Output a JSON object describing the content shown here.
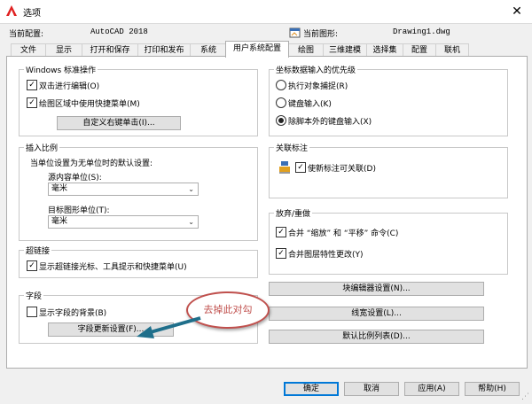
{
  "window": {
    "title": "选项",
    "close_label": "✕"
  },
  "profile": {
    "current_profile_label": "当前配置:",
    "current_profile_value": "AutoCAD 2018",
    "current_drawing_label": "当前图形:",
    "current_drawing_value": "Drawing1.dwg"
  },
  "tabs": [
    {
      "label": "文件"
    },
    {
      "label": "显示"
    },
    {
      "label": "打开和保存"
    },
    {
      "label": "打印和发布"
    },
    {
      "label": "系统"
    },
    {
      "label": "用户系统配置",
      "active": true
    },
    {
      "label": "绘图"
    },
    {
      "label": "三维建模"
    },
    {
      "label": "选择集"
    },
    {
      "label": "配置"
    },
    {
      "label": "联机"
    }
  ],
  "windows_std": {
    "title": "Windows 标准操作",
    "double_click_edit": {
      "label": "双击进行编辑(O)",
      "checked": true
    },
    "shortcut_menus": {
      "label": "绘图区域中使用快捷菜单(M)",
      "checked": true
    },
    "custom_right_click_button": "自定义右键单击(I)..."
  },
  "insertion_scale": {
    "title": "插入比例",
    "description": "当单位设置为无单位时的默认设置:",
    "source_label": "源内容单位(S):",
    "source_value": "毫米",
    "target_label": "目标图形单位(T):",
    "target_value": "毫米"
  },
  "hyperlink": {
    "title": "超链接",
    "show_cursor": {
      "label": "显示超链接光标、工具提示和快捷菜单(U)",
      "checked": true
    }
  },
  "fields": {
    "title": "字段",
    "show_background": {
      "label": "显示字段的背景(B)",
      "checked": false
    },
    "update_settings_button": "字段更新设置(F)..."
  },
  "coord_priority": {
    "title": "坐标数据输入的优先级",
    "options": [
      {
        "label": "执行对象捕捉(R)",
        "selected": false
      },
      {
        "label": "键盘输入(K)",
        "selected": false
      },
      {
        "label": "除脚本外的键盘输入(X)",
        "selected": true
      }
    ]
  },
  "assoc_dim": {
    "title": "关联标注",
    "make_new_assoc": {
      "label": "使新标注可关联(D)",
      "checked": true
    }
  },
  "undo_redo": {
    "title": "放弃/重做",
    "combine_zoom_pan": {
      "label": "合并 “缩放” 和 “平移” 命令(C)",
      "checked": true
    },
    "combine_layer_prop": {
      "label": "合并图层特性更改(Y)",
      "checked": true
    }
  },
  "right_buttons": {
    "block_editor": "块编辑器设置(N)...",
    "lineweight": "线宽设置(L)...",
    "default_scale_list": "默认比例列表(D)..."
  },
  "annotation": {
    "text": "去掉此对勾",
    "color": "#c0504d",
    "arrow_color": "#1f6f8b"
  },
  "footer": {
    "ok": "确定",
    "cancel": "取消",
    "apply": "应用(A)",
    "help": "帮助(H)"
  },
  "colors": {
    "accent": "#0078d7",
    "app_icon": "#e02020"
  }
}
